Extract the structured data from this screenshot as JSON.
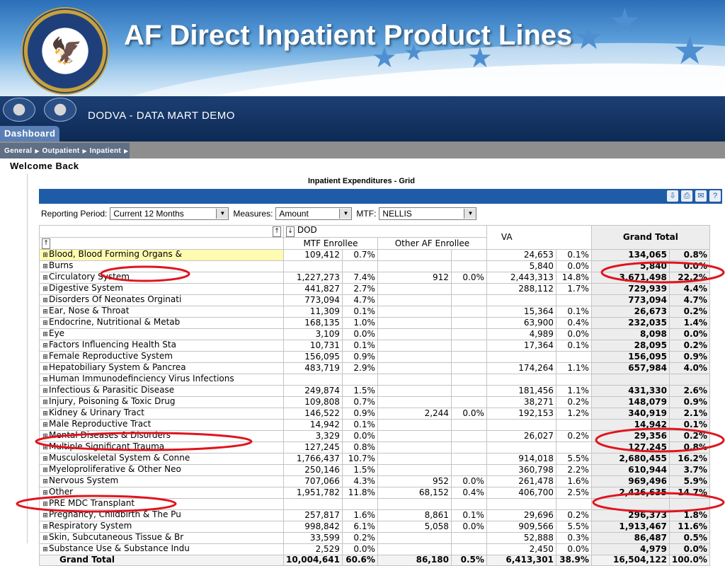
{
  "slide": {
    "title": "AF Direct Inpatient Product Lines"
  },
  "app": {
    "title": "DODVA - DATA MART DEMO",
    "tab": "Dashboard",
    "subnav": [
      "General",
      "Outpatient",
      "Inpatient"
    ],
    "welcome": "Welcome Back"
  },
  "grid": {
    "title": "Inpatient Expenditures - Grid",
    "filters": {
      "period_label": "Reporting Period:",
      "period_value": "Current 12 Months",
      "measures_label": "Measures:",
      "measures_value": "Amount",
      "mtf_label": "MTF:",
      "mtf_value": "NELLIS"
    },
    "headers": {
      "group": "DOD",
      "mtf": "MTF Enrollee",
      "other": "Other AF Enrollee",
      "va": "VA",
      "grand_total": "Grand Total"
    },
    "rows": [
      {
        "label": "Blood, Blood Forming Organs &",
        "mtf": "109,412",
        "mtf_pct": "0.7%",
        "other": "",
        "other_pct": "",
        "va": "24,653",
        "va_pct": "0.1%",
        "gt": "134,065",
        "gt_pct": "0.8%"
      },
      {
        "label": "Burns",
        "mtf": "",
        "mtf_pct": "",
        "other": "",
        "other_pct": "",
        "va": "5,840",
        "va_pct": "0.0%",
        "gt": "5,840",
        "gt_pct": "0.0%"
      },
      {
        "label": "Circulatory System",
        "mtf": "1,227,273",
        "mtf_pct": "7.4%",
        "other": "912",
        "other_pct": "0.0%",
        "va": "2,443,313",
        "va_pct": "14.8%",
        "gt": "3,671,498",
        "gt_pct": "22.2%"
      },
      {
        "label": "Digestive System",
        "mtf": "441,827",
        "mtf_pct": "2.7%",
        "other": "",
        "other_pct": "",
        "va": "288,112",
        "va_pct": "1.7%",
        "gt": "729,939",
        "gt_pct": "4.4%"
      },
      {
        "label": "Disorders Of Neonates Orginati",
        "mtf": "773,094",
        "mtf_pct": "4.7%",
        "other": "",
        "other_pct": "",
        "va": "",
        "va_pct": "",
        "gt": "773,094",
        "gt_pct": "4.7%"
      },
      {
        "label": "Ear, Nose & Throat",
        "mtf": "11,309",
        "mtf_pct": "0.1%",
        "other": "",
        "other_pct": "",
        "va": "15,364",
        "va_pct": "0.1%",
        "gt": "26,673",
        "gt_pct": "0.2%"
      },
      {
        "label": "Endocrine, Nutritional & Metab",
        "mtf": "168,135",
        "mtf_pct": "1.0%",
        "other": "",
        "other_pct": "",
        "va": "63,900",
        "va_pct": "0.4%",
        "gt": "232,035",
        "gt_pct": "1.4%"
      },
      {
        "label": "Eye",
        "mtf": "3,109",
        "mtf_pct": "0.0%",
        "other": "",
        "other_pct": "",
        "va": "4,989",
        "va_pct": "0.0%",
        "gt": "8,098",
        "gt_pct": "0.0%"
      },
      {
        "label": "Factors Influencing Health Sta",
        "mtf": "10,731",
        "mtf_pct": "0.1%",
        "other": "",
        "other_pct": "",
        "va": "17,364",
        "va_pct": "0.1%",
        "gt": "28,095",
        "gt_pct": "0.2%"
      },
      {
        "label": "Female Reproductive System",
        "mtf": "156,095",
        "mtf_pct": "0.9%",
        "other": "",
        "other_pct": "",
        "va": "",
        "va_pct": "",
        "gt": "156,095",
        "gt_pct": "0.9%"
      },
      {
        "label": "Hepatobiliary System & Pancrea",
        "mtf": "483,719",
        "mtf_pct": "2.9%",
        "other": "",
        "other_pct": "",
        "va": "174,264",
        "va_pct": "1.1%",
        "gt": "657,984",
        "gt_pct": "4.0%"
      },
      {
        "label": "Human Immunodefinciency Virus Infections",
        "mtf": "",
        "mtf_pct": "",
        "other": "",
        "other_pct": "",
        "va": "",
        "va_pct": "",
        "gt": "",
        "gt_pct": ""
      },
      {
        "label": "Infectious & Parasitic Disease",
        "mtf": "249,874",
        "mtf_pct": "1.5%",
        "other": "",
        "other_pct": "",
        "va": "181,456",
        "va_pct": "1.1%",
        "gt": "431,330",
        "gt_pct": "2.6%"
      },
      {
        "label": "Injury, Poisoning & Toxic Drug",
        "mtf": "109,808",
        "mtf_pct": "0.7%",
        "other": "",
        "other_pct": "",
        "va": "38,271",
        "va_pct": "0.2%",
        "gt": "148,079",
        "gt_pct": "0.9%"
      },
      {
        "label": "Kidney & Urinary Tract",
        "mtf": "146,522",
        "mtf_pct": "0.9%",
        "other": "2,244",
        "other_pct": "0.0%",
        "va": "192,153",
        "va_pct": "1.2%",
        "gt": "340,919",
        "gt_pct": "2.1%"
      },
      {
        "label": "Male Reproductive Tract",
        "mtf": "14,942",
        "mtf_pct": "0.1%",
        "other": "",
        "other_pct": "",
        "va": "",
        "va_pct": "",
        "gt": "14,942",
        "gt_pct": "0.1%"
      },
      {
        "label": "Mental Diseases & Disorders",
        "mtf": "3,329",
        "mtf_pct": "0.0%",
        "other": "",
        "other_pct": "",
        "va": "26,027",
        "va_pct": "0.2%",
        "gt": "29,356",
        "gt_pct": "0.2%"
      },
      {
        "label": "Multiple Significant Trauma",
        "mtf": "127,245",
        "mtf_pct": "0.8%",
        "other": "",
        "other_pct": "",
        "va": "",
        "va_pct": "",
        "gt": "127,245",
        "gt_pct": "0.8%"
      },
      {
        "label": "Musculoskeletal System & Conne",
        "mtf": "1,766,437",
        "mtf_pct": "10.7%",
        "other": "",
        "other_pct": "",
        "va": "914,018",
        "va_pct": "5.5%",
        "gt": "2,680,455",
        "gt_pct": "16.2%"
      },
      {
        "label": "Myeloproliferative & Other Neo",
        "mtf": "250,146",
        "mtf_pct": "1.5%",
        "other": "",
        "other_pct": "",
        "va": "360,798",
        "va_pct": "2.2%",
        "gt": "610,944",
        "gt_pct": "3.7%"
      },
      {
        "label": "Nervous System",
        "mtf": "707,066",
        "mtf_pct": "4.3%",
        "other": "952",
        "other_pct": "0.0%",
        "va": "261,478",
        "va_pct": "1.6%",
        "gt": "969,496",
        "gt_pct": "5.9%"
      },
      {
        "label": "Other",
        "mtf": "1,951,782",
        "mtf_pct": "11.8%",
        "other": "68,152",
        "other_pct": "0.4%",
        "va": "406,700",
        "va_pct": "2.5%",
        "gt": "2,426,635",
        "gt_pct": "14.7%"
      },
      {
        "label": "PRE MDC Transplant",
        "mtf": "",
        "mtf_pct": "",
        "other": "",
        "other_pct": "",
        "va": "",
        "va_pct": "",
        "gt": "",
        "gt_pct": ""
      },
      {
        "label": "Pregnancy, Childbirth & The Pu",
        "mtf": "257,817",
        "mtf_pct": "1.6%",
        "other": "8,861",
        "other_pct": "0.1%",
        "va": "29,696",
        "va_pct": "0.2%",
        "gt": "296,373",
        "gt_pct": "1.8%"
      },
      {
        "label": "Respiratory System",
        "mtf": "998,842",
        "mtf_pct": "6.1%",
        "other": "5,058",
        "other_pct": "0.0%",
        "va": "909,566",
        "va_pct": "5.5%",
        "gt": "1,913,467",
        "gt_pct": "11.6%"
      },
      {
        "label": "Skin, Subcutaneous Tissue & Br",
        "mtf": "33,599",
        "mtf_pct": "0.2%",
        "other": "",
        "other_pct": "",
        "va": "52,888",
        "va_pct": "0.3%",
        "gt": "86,487",
        "gt_pct": "0.5%"
      },
      {
        "label": "Substance Use & Substance Indu",
        "mtf": "2,529",
        "mtf_pct": "0.0%",
        "other": "",
        "other_pct": "",
        "va": "2,450",
        "va_pct": "0.0%",
        "gt": "4,979",
        "gt_pct": "0.0%"
      }
    ],
    "total": {
      "label": "Grand Total",
      "mtf": "10,004,641",
      "mtf_pct": "60.6%",
      "other": "86,180",
      "other_pct": "0.5%",
      "va": "6,413,301",
      "va_pct": "38.9%",
      "gt": "16,504,122",
      "gt_pct": "100.0%"
    }
  },
  "colors": {
    "header_blue": "#1c3f73",
    "grid_bar": "#1f5ca8",
    "annotation": "#e0141e",
    "highlight_row": "#fffbb0"
  },
  "icons": [
    "va-seal",
    "dod-seal-icon",
    "va-seal-icon",
    "export-icon",
    "print-icon",
    "email-icon",
    "help-icon",
    "expand-icon",
    "collapse-icon"
  ]
}
